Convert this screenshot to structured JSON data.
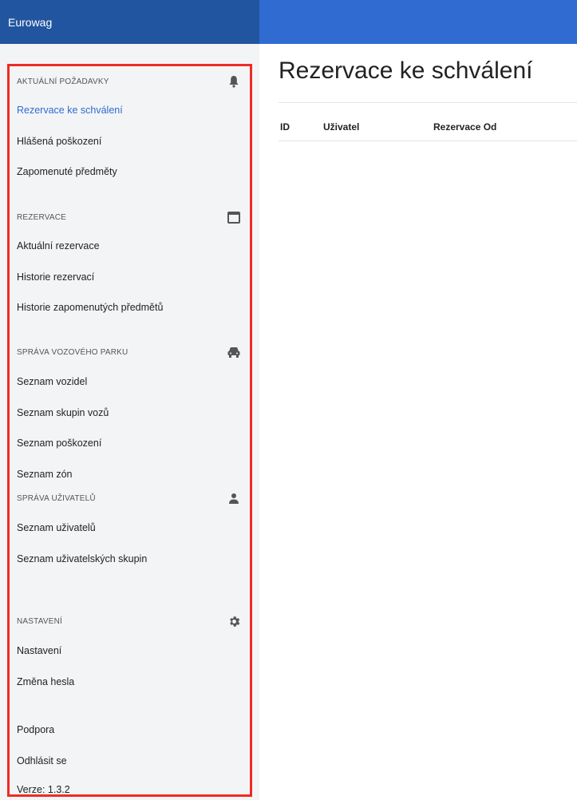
{
  "header": {
    "brand": "Eurowag"
  },
  "sidebar": {
    "sections": [
      {
        "title": "AKTUÁLNÍ POŽADAVKY",
        "icon": "bell-icon",
        "items": [
          "Rezervace ke schválení",
          "Hlášená poškození",
          "Zapomenuté předměty"
        ]
      },
      {
        "title": "REZERVACE",
        "icon": "calendar-icon",
        "items": [
          "Aktuální rezervace",
          "Historie rezervací",
          "Historie zapomenutých předmětů"
        ]
      },
      {
        "title": "SPRÁVA VOZOVÉHO PARKU",
        "icon": "car-icon",
        "items": [
          "Seznam vozidel",
          "Seznam skupin vozů",
          "Seznam poškození",
          "Seznam zón"
        ]
      },
      {
        "title": "SPRÁVA UŽIVATELŮ",
        "icon": "user-icon",
        "items": [
          "Seznam uživatelů",
          "Seznam uživatelských skupin"
        ]
      },
      {
        "title": "NASTAVENÍ",
        "icon": "gear-icon",
        "items": [
          "Nastavení",
          "Změna hesla"
        ]
      }
    ],
    "footer_items": [
      "Podpora",
      "Odhlásit se"
    ],
    "version": "Verze: 1.3.2",
    "active_item": "Rezervace ke schválení"
  },
  "main": {
    "title": "Rezervace ke schválení",
    "table": {
      "columns": [
        "ID",
        "Uživatel",
        "Rezervace Od"
      ]
    }
  },
  "colors": {
    "accent": "#2f6bd1",
    "brand_bar": "#22559f",
    "highlight_border": "#ee2b22"
  }
}
